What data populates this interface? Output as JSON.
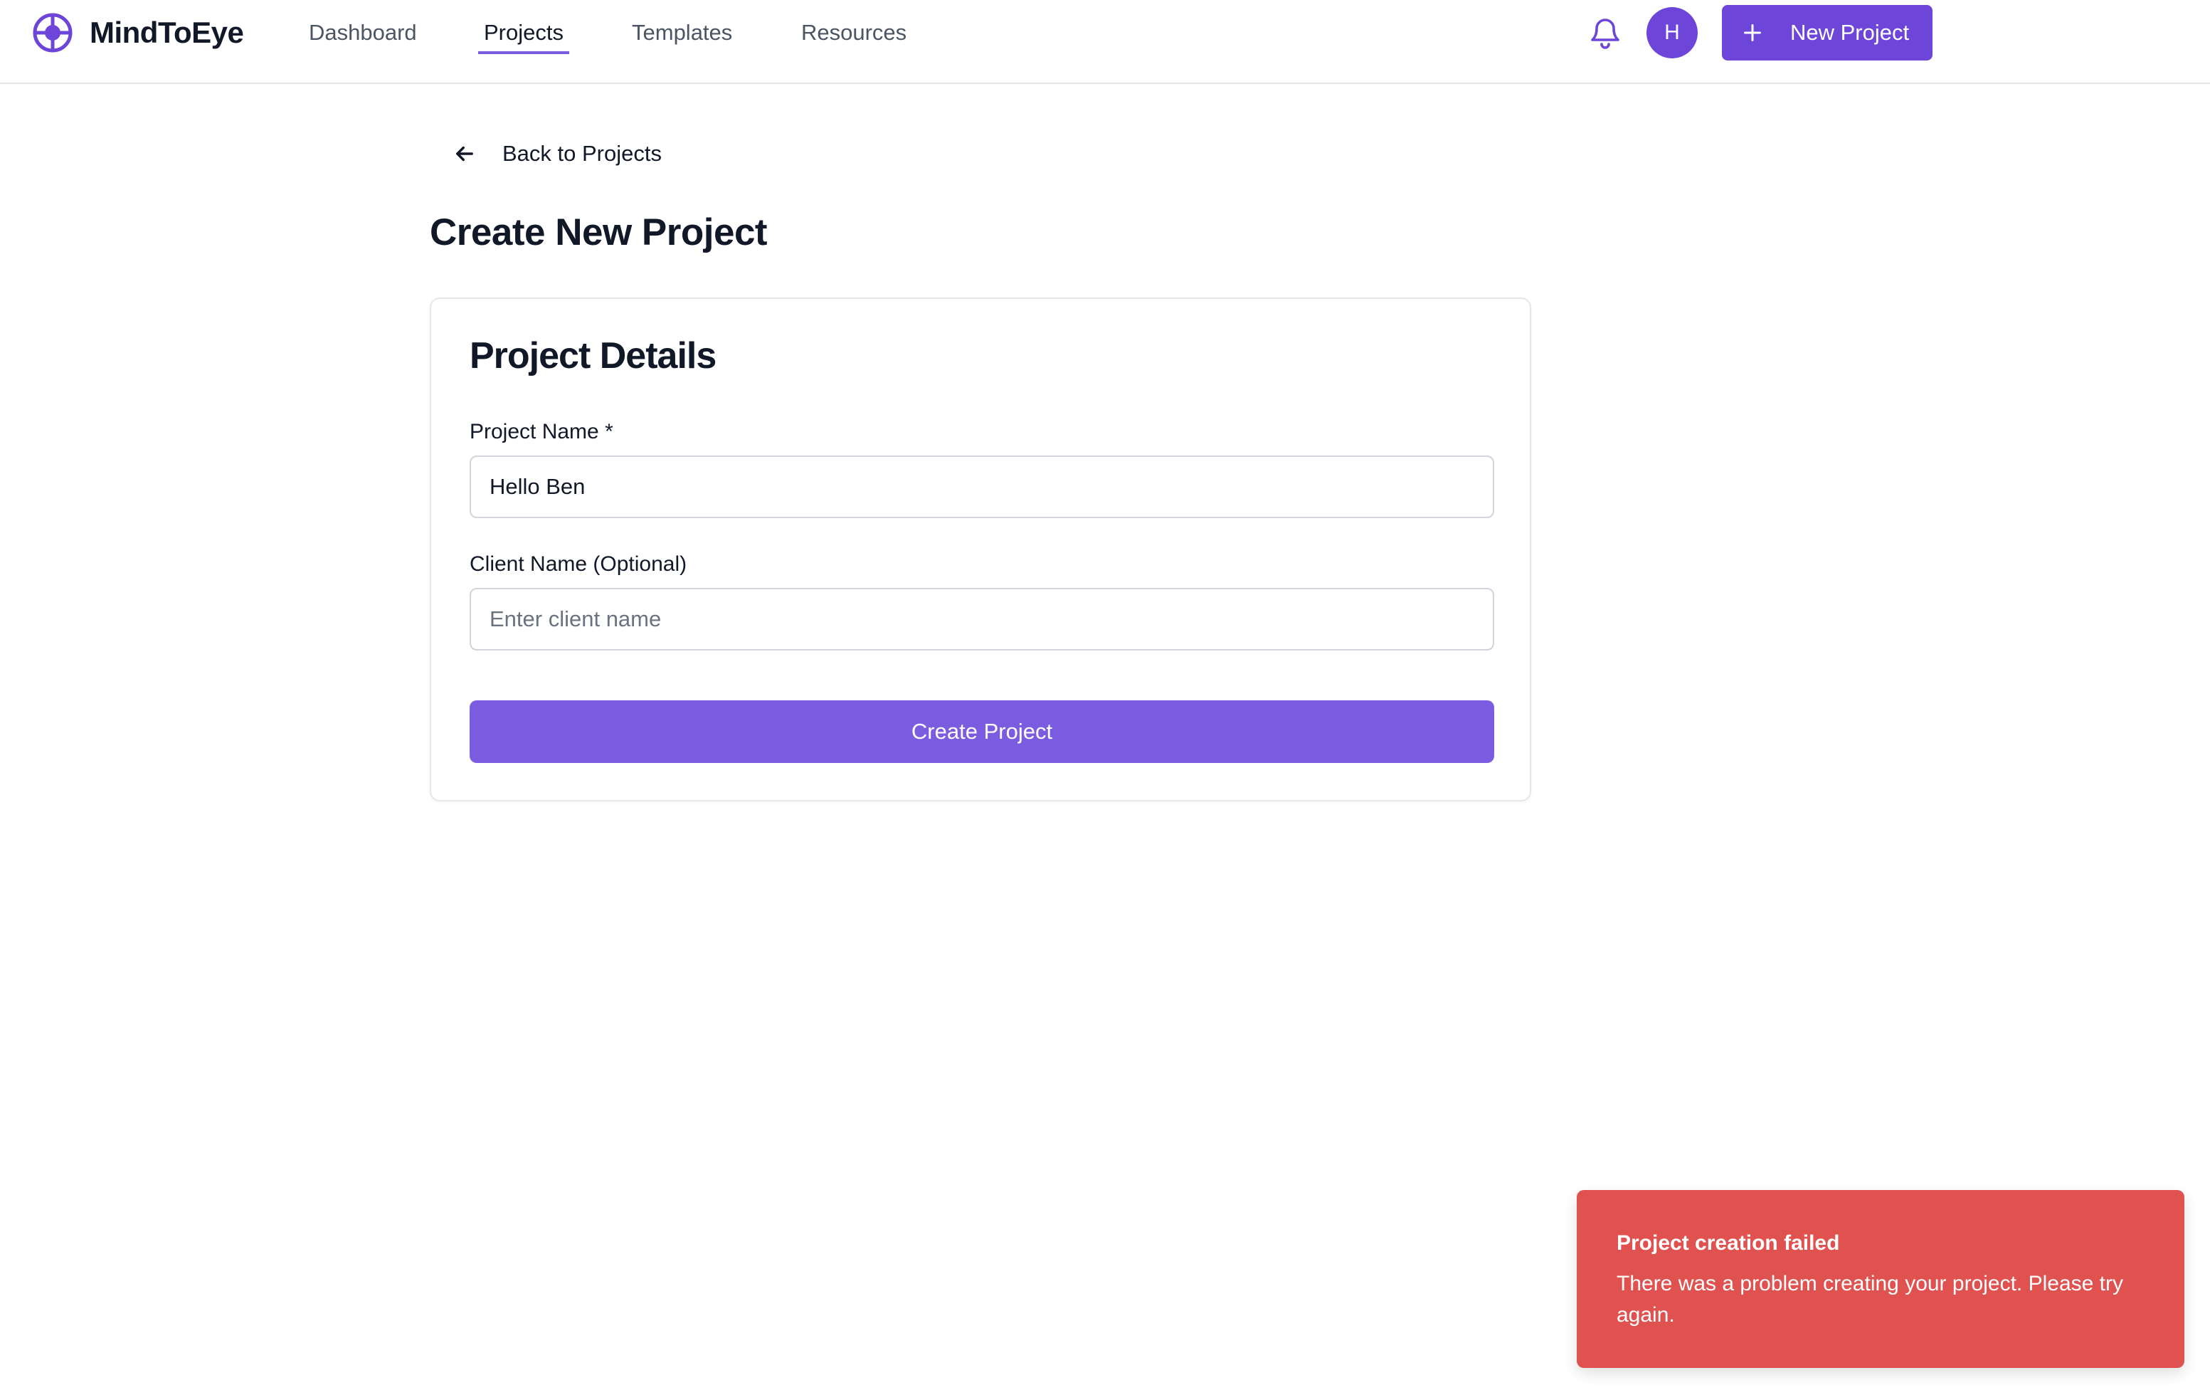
{
  "brand": {
    "name": "MindToEye",
    "logo_icon": "crosshair-logo-icon",
    "color": "#6d45d9"
  },
  "nav": {
    "items": [
      {
        "label": "Dashboard",
        "active": false
      },
      {
        "label": "Projects",
        "active": true
      },
      {
        "label": "Templates",
        "active": false
      },
      {
        "label": "Resources",
        "active": false
      }
    ]
  },
  "header": {
    "notifications_icon": "bell-icon",
    "avatar_initial": "H",
    "new_project_label": "New Project",
    "new_project_icon": "plus-icon"
  },
  "main": {
    "back_label": "Back to Projects",
    "back_icon": "arrow-left-icon",
    "title": "Create New Project"
  },
  "form": {
    "card_title": "Project Details",
    "project_name": {
      "label": "Project Name *",
      "value": "Hello Ben"
    },
    "client_name": {
      "label": "Client Name (Optional)",
      "value": "",
      "placeholder": "Enter client name"
    },
    "submit_label": "Create Project"
  },
  "toast": {
    "title": "Project creation failed",
    "message": "There was a problem creating your project. Please try again.",
    "color": "#e0524f"
  },
  "colors": {
    "accent": "#7b5ce1",
    "accent_dark": "#6d45d9",
    "error": "#e0524f"
  }
}
